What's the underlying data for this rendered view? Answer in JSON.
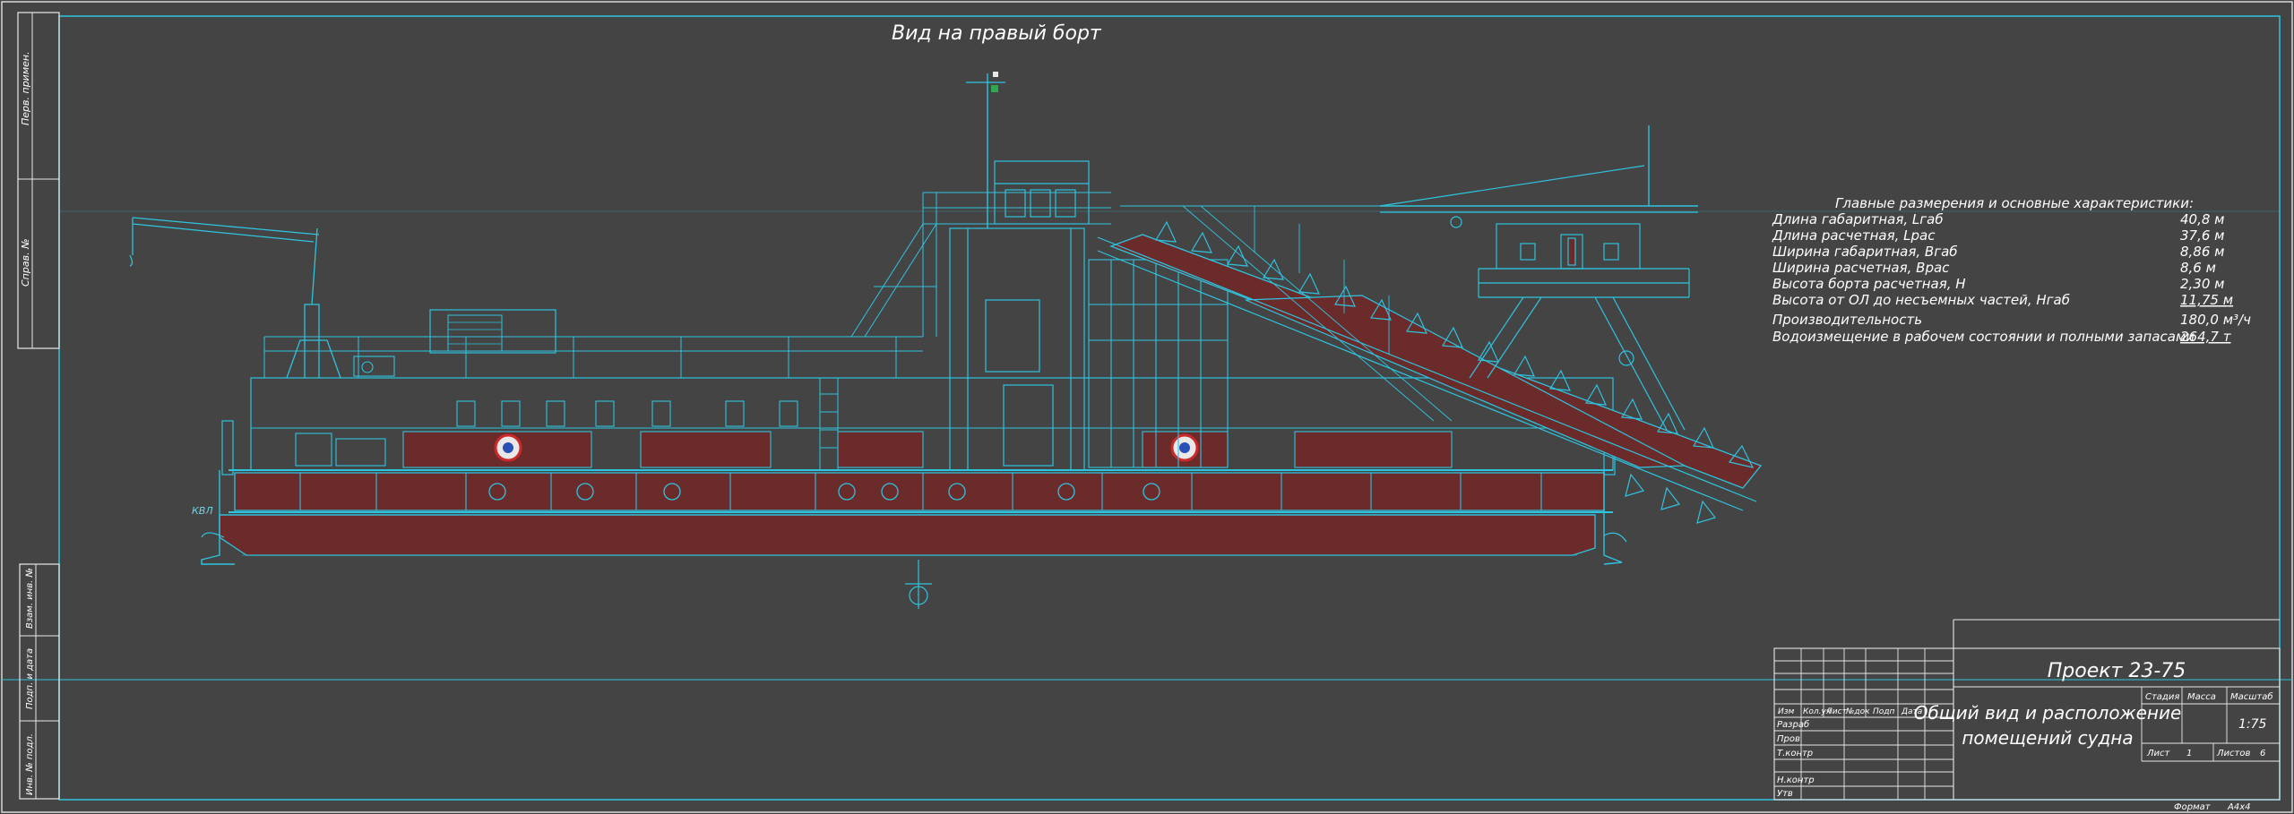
{
  "view_title": "Вид на правый борт",
  "waterline_label": "КВЛ",
  "specs": {
    "heading": "Главные размерения и основные характеристики:",
    "rows": [
      {
        "label": "Длина габаритная, Lгаб",
        "value": "40,8 м"
      },
      {
        "label": "Длина расчетная, Lрас",
        "value": "37,6 м"
      },
      {
        "label": "Ширина габаритная, Bгаб",
        "value": "8,86 м"
      },
      {
        "label": "Ширина расчетная, Bрас",
        "value": "8,6 м"
      },
      {
        "label": "Высота борта расчетная, Н",
        "value": "2,30 м"
      },
      {
        "label": "Высота от ОЛ до несъемных частей, Нгаб",
        "value": "11,75 м"
      },
      {
        "label": "Производительность",
        "value": "180,0 м³/ч"
      },
      {
        "label": "Водоизмещение в рабочем состоянии и полными запасами",
        "value": "264,7 т"
      }
    ]
  },
  "left_stamp": [
    "Перв. примен.",
    "Справ. №",
    "Взам. инв. №",
    "Подп. и дата",
    "Инв. № подл."
  ],
  "title_block": {
    "project": "Проект 23-75",
    "drawing_title_1": "Общий вид и расположение",
    "drawing_title_2": "помещений судна",
    "col_headers": [
      "Изм",
      "Кол.уч",
      "Лист",
      "№док",
      "Подп",
      "Дата"
    ],
    "roles": [
      "Разраб",
      "Пров",
      "Т.контр",
      "Н.контр",
      "Утв"
    ],
    "stage_header": "Стадия",
    "mass_header": "Масса",
    "scale_header": "Масштаб",
    "scale_value": "1:75",
    "sheet_label": "Лист",
    "sheet_value": "1",
    "sheets_label": "Листов",
    "sheets_value": "6",
    "format_label": "Формат",
    "format_value": "A4x4"
  },
  "colors": {
    "background": "#444444",
    "linework": "#2fc3df",
    "hull_fill": "#6b2b2b",
    "frame_white": "#e8e8e8",
    "text": "#ffffff"
  }
}
